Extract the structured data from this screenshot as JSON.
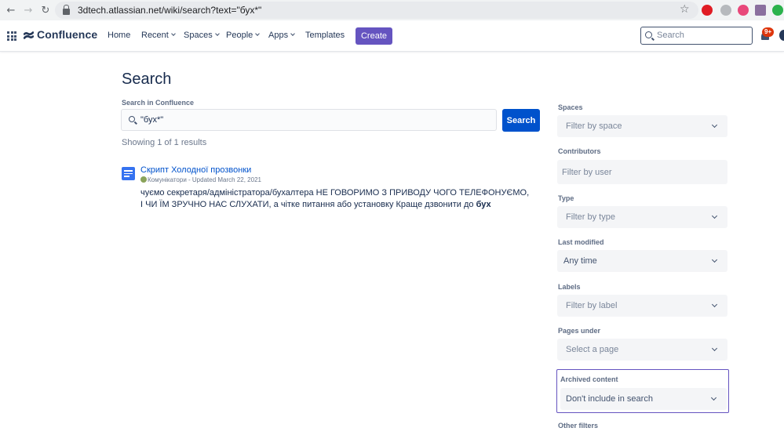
{
  "browser": {
    "url": "3dtech.atlassian.net/wiki/search?text=\"бух*\""
  },
  "header": {
    "app_name": "Confluence",
    "nav": [
      {
        "label": "Home"
      },
      {
        "label": "Recent"
      },
      {
        "label": "Spaces"
      },
      {
        "label": "People"
      },
      {
        "label": "Apps"
      },
      {
        "label": "Templates"
      }
    ],
    "create_label": "Create",
    "search_placeholder": "Search",
    "notification_badge": "9+",
    "accent_color": "#6554c0"
  },
  "main": {
    "title": "Search",
    "search_label": "Search in Confluence",
    "search_value": "\"бух*\"",
    "search_button": "Search",
    "showing": "Showing 1 of 1 results",
    "results": [
      {
        "title": "Скрипт Холодної прозвонки",
        "space": "Комунікатори",
        "updated": " - Updated March 22, 2021",
        "snippet_before": "чуємо  секретаря/адміністратора/бухалтера  НЕ ГОВОРИМО З ПРИВОДУ ЧОГО ТЕЛЕФОНУЄМО, І ЧИ ЇМ ЗРУЧНО НАС СЛУХАТИ, а чітке питання або установку Краще дзвонити до ",
        "snippet_highlight": "бух"
      }
    ]
  },
  "filters": {
    "spaces": {
      "label": "Spaces",
      "placeholder": "Filter by space"
    },
    "contributors": {
      "label": "Contributors",
      "placeholder": "Filter by user"
    },
    "type": {
      "label": "Type",
      "placeholder": "Filter by type"
    },
    "last_modified": {
      "label": "Last modified",
      "value": "Any time"
    },
    "labels": {
      "label": "Labels",
      "placeholder": "Filter by label"
    },
    "pages_under": {
      "label": "Pages under",
      "placeholder": "Select a page"
    },
    "archived": {
      "label": "Archived content",
      "value": "Don't include in search"
    },
    "other": {
      "label": "Other filters"
    }
  }
}
